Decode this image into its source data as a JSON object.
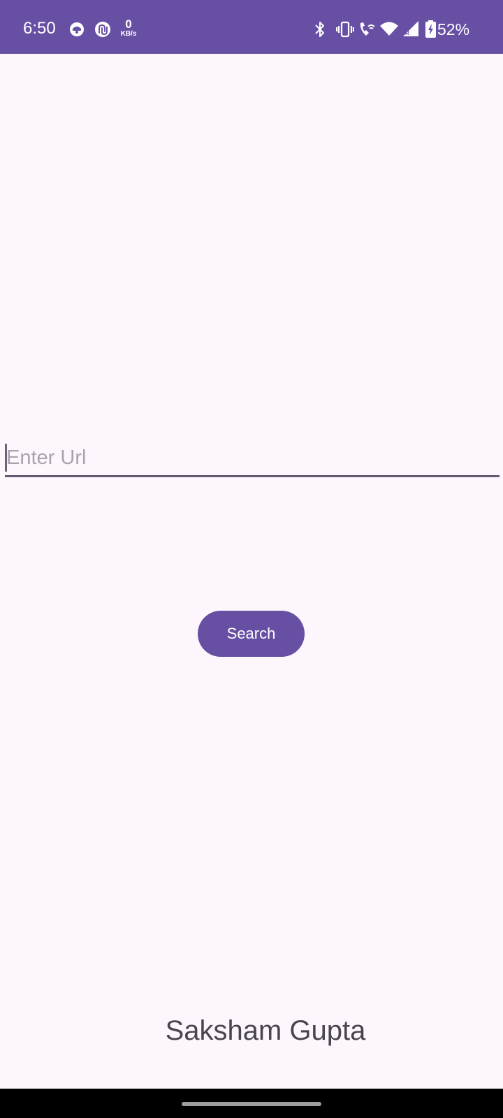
{
  "status_bar": {
    "time": "6:50",
    "net_speed_value": "0",
    "net_speed_unit": "KB/s",
    "battery_percent": "52%",
    "background_color": "#6750a4",
    "icons": [
      "notification-app-icon",
      "sync-app-icon",
      "bluetooth-icon",
      "vibrate-icon",
      "wifi-calling-icon",
      "wifi-icon",
      "cellular-signal-icon",
      "battery-charging-icon"
    ]
  },
  "url_input": {
    "placeholder": "Enter Url",
    "value": ""
  },
  "search_button": {
    "label": "Search",
    "color": "#6750a4"
  },
  "footer": {
    "author": "Saksham Gupta"
  }
}
